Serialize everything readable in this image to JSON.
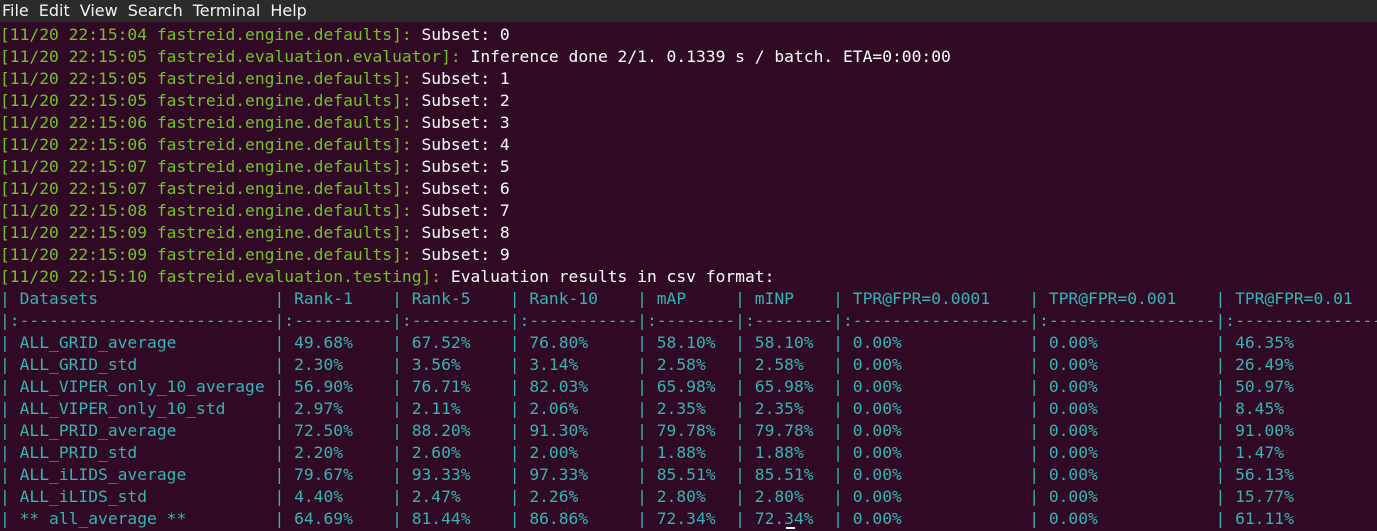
{
  "menu": [
    "File",
    "Edit",
    "View",
    "Search",
    "Terminal",
    "Help"
  ],
  "log_lines": [
    {
      "prefix": "[11/20 22:15:04 fastreid.engine.defaults]: ",
      "message": "Subset: 0"
    },
    {
      "prefix": "[11/20 22:15:05 fastreid.evaluation.evaluator]: ",
      "message": "Inference done 2/1. 0.1339 s / batch. ETA=0:00:00"
    },
    {
      "prefix": "[11/20 22:15:05 fastreid.engine.defaults]: ",
      "message": "Subset: 1"
    },
    {
      "prefix": "[11/20 22:15:05 fastreid.engine.defaults]: ",
      "message": "Subset: 2"
    },
    {
      "prefix": "[11/20 22:15:06 fastreid.engine.defaults]: ",
      "message": "Subset: 3"
    },
    {
      "prefix": "[11/20 22:15:06 fastreid.engine.defaults]: ",
      "message": "Subset: 4"
    },
    {
      "prefix": "[11/20 22:15:07 fastreid.engine.defaults]: ",
      "message": "Subset: 5"
    },
    {
      "prefix": "[11/20 22:15:07 fastreid.engine.defaults]: ",
      "message": "Subset: 6"
    },
    {
      "prefix": "[11/20 22:15:08 fastreid.engine.defaults]: ",
      "message": "Subset: 7"
    },
    {
      "prefix": "[11/20 22:15:09 fastreid.engine.defaults]: ",
      "message": "Subset: 8"
    },
    {
      "prefix": "[11/20 22:15:09 fastreid.engine.defaults]: ",
      "message": "Subset: 9"
    },
    {
      "prefix": "[11/20 22:15:10 fastreid.evaluation.testing]: ",
      "message": "Evaluation results in csv format:"
    }
  ],
  "table_lines": [
    "| Datasets                  | Rank-1    | Rank-5    | Rank-10    | mAP     | mINP    | TPR@FPR=0.0001    | TPR@FPR=0.001    | TPR@FPR=0.01    |",
    "|:--------------------------|:----------|:----------|:-----------|:--------|:--------|:------------------|:-----------------|:----------------|",
    "| ALL_GRID_average          | 49.68%    | 67.52%    | 76.80%     | 58.10%  | 58.10%  | 0.00%             | 0.00%            | 46.35%          |",
    "| ALL_GRID_std              | 2.30%     | 3.56%     | 3.14%      | 2.58%   | 2.58%   | 0.00%             | 0.00%            | 26.49%          |",
    "| ALL_VIPER_only_10_average | 56.90%    | 76.71%    | 82.03%     | 65.98%  | 65.98%  | 0.00%             | 0.00%            | 50.97%          |",
    "| ALL_VIPER_only_10_std     | 2.97%     | 2.11%     | 2.06%      | 2.35%   | 2.35%   | 0.00%             | 0.00%            | 8.45%           |",
    "| ALL_PRID_average          | 72.50%    | 88.20%    | 91.30%     | 79.78%  | 79.78%  | 0.00%             | 0.00%            | 91.00%          |",
    "| ALL_PRID_std              | 2.20%     | 2.60%     | 2.00%      | 1.88%   | 1.88%   | 0.00%             | 0.00%            | 1.47%           |",
    "| ALL_iLIDS_average         | 79.67%    | 93.33%    | 97.33%     | 85.51%  | 85.51%  | 0.00%             | 0.00%            | 56.13%          |",
    "| ALL_iLIDS_std             | 4.40%     | 2.47%     | 2.26%      | 2.80%   | 2.80%   | 0.00%             | 0.00%            | 15.77%          |",
    "| ** all_average **         | 64.69%    | 81.44%    | 86.86%     | 72.34%  | 72.34%  | 0.00%             | 0.00%            | 61.11%          |"
  ],
  "colors": {
    "background": "#300a24",
    "prefix": "#73c224",
    "table": "#34b4b4",
    "text": "#ffffff"
  }
}
